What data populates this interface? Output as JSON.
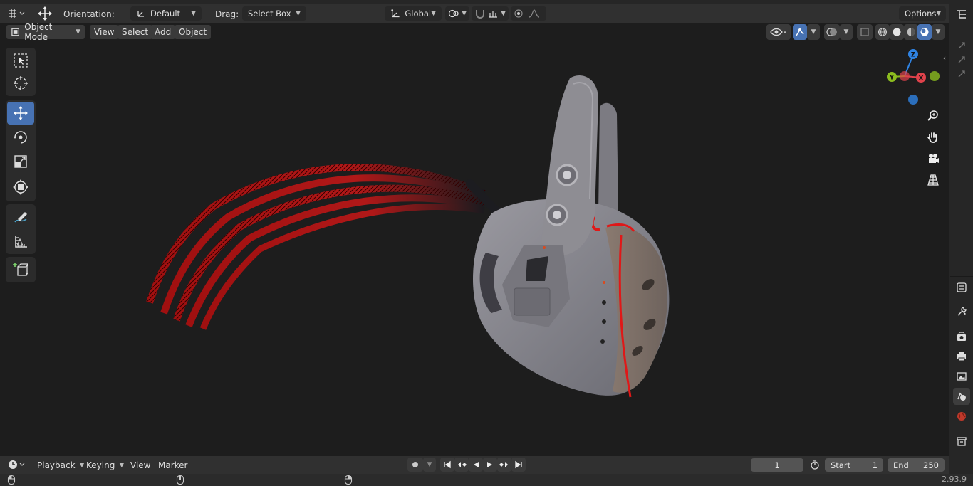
{
  "tool_header": {
    "orientation_label": "Orientation:",
    "orientation_value": "Default",
    "drag_label": "Drag:",
    "drag_value": "Select Box",
    "transform_orientation": "Global",
    "options_label": "Options"
  },
  "view_header": {
    "mode": "Object Mode",
    "menus": [
      "View",
      "Select",
      "Add",
      "Object"
    ]
  },
  "toolbar": {
    "tools": [
      "select-box",
      "cursor",
      "move",
      "rotate",
      "scale",
      "transform",
      "annotate",
      "measure",
      "add-cube"
    ],
    "active_tool": "move"
  },
  "navigation_gizmo": {
    "axes": [
      "Z",
      "Y",
      "X"
    ]
  },
  "timeline": {
    "menus": [
      "Playback",
      "Keying",
      "View",
      "Marker"
    ],
    "current_frame": "1",
    "start_label": "Start",
    "start_value": "1",
    "end_label": "End",
    "end_value": "250"
  },
  "status": {
    "version": "2.93.9"
  },
  "colors": {
    "accent": "#4772b3",
    "axis_x": "#e0424b",
    "axis_y": "#8bbc1f",
    "axis_z": "#2f83e3",
    "model_body": "#807f86",
    "model_hair": "#b01818"
  }
}
